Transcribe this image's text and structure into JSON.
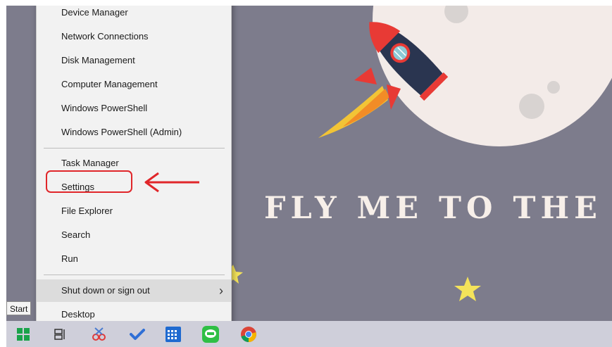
{
  "wallpaper": {
    "headline": "FLY ME TO THE M"
  },
  "context_menu": {
    "group1": [
      "Device Manager",
      "Network Connections",
      "Disk Management",
      "Computer Management",
      "Windows PowerShell",
      "Windows PowerShell (Admin)"
    ],
    "group2": [
      "Task Manager",
      "Settings",
      "File Explorer",
      "Search",
      "Run"
    ],
    "group3": [
      "Shut down or sign out",
      "Desktop"
    ],
    "highlighted_item": "Settings",
    "highlight_color": "#e0262a"
  },
  "taskbar": {
    "start_tooltip": "Start",
    "icons": [
      "windows-start-icon",
      "task-view-icon",
      "snipping-tool-icon",
      "todo-check-icon",
      "calendar-app-icon",
      "line-app-icon",
      "chrome-icon"
    ]
  },
  "colors": {
    "wallpaper_bg": "#7d7c8c",
    "moon": "#f3ebe8",
    "menu_bg": "#f2f2f2",
    "taskbar_bg": "#cfcfda",
    "star": "#f4e35a"
  }
}
